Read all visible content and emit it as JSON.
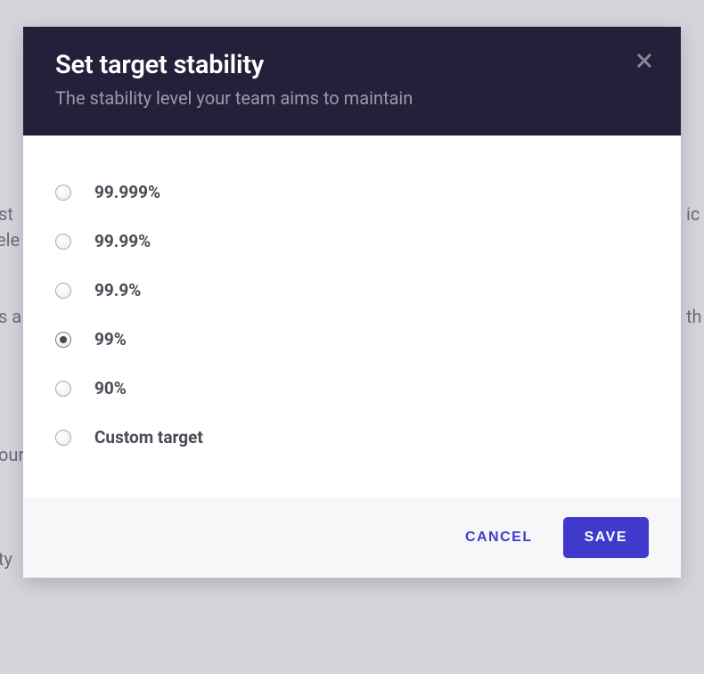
{
  "modal": {
    "title": "Set target stability",
    "subtitle": "The stability level your team aims to maintain",
    "options": [
      {
        "label": "99.999%",
        "selected": false
      },
      {
        "label": "99.99%",
        "selected": false
      },
      {
        "label": "99.9%",
        "selected": false
      },
      {
        "label": "99%",
        "selected": true
      },
      {
        "label": "90%",
        "selected": false
      },
      {
        "label": "Custom target",
        "selected": false
      }
    ],
    "footer": {
      "cancel_label": "CANCEL",
      "save_label": "SAVE"
    }
  },
  "colors": {
    "header_bg": "#24203a",
    "primary": "#3f3acb",
    "overlay": "#d4d4db"
  }
}
